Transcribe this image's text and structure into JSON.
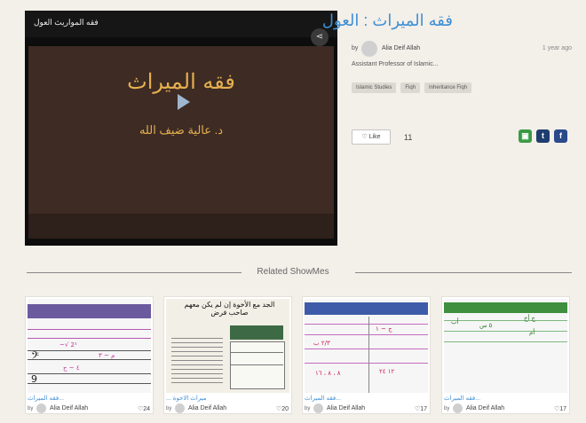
{
  "player": {
    "overlay_title": "فقه المواريث العول",
    "share_glyph": "⋖",
    "slide_title": "فقه الميراث",
    "slide_author": "د. عالية ضيف الله"
  },
  "showme": {
    "title": "فقه الميراث : العول",
    "by": "by",
    "author": "Alia Deif Allah",
    "time": "1 year ago",
    "bio": "Assistant Professor of Islamic...",
    "tags": [
      "Islamic Studies",
      "Fiqh",
      "Inheritance Fiqh"
    ],
    "like_label": "♡ Like",
    "likes": "11"
  },
  "social": {
    "gc": "▣",
    "tw": "t",
    "fb": "f"
  },
  "related": {
    "heading": "Related ShowMes",
    "cards": [
      {
        "title": "...فقه الميراث",
        "by": "by",
        "author": "Alia Deif Allah",
        "likes": "♡24"
      },
      {
        "title": "ميراث الاخوة ...",
        "by": "by",
        "author": "Alia Deif Allah",
        "likes": "♡20"
      },
      {
        "title": "...فقه الميراث",
        "by": "by",
        "author": "Alia Deif Allah",
        "likes": "♡17"
      },
      {
        "title": "...فقه الميراث",
        "by": "by",
        "author": "Alia Deif Allah",
        "likes": "♡17"
      }
    ],
    "card2_heading": "الجد مع الأخوة إن لم يكن معهم صاحب فرض"
  }
}
